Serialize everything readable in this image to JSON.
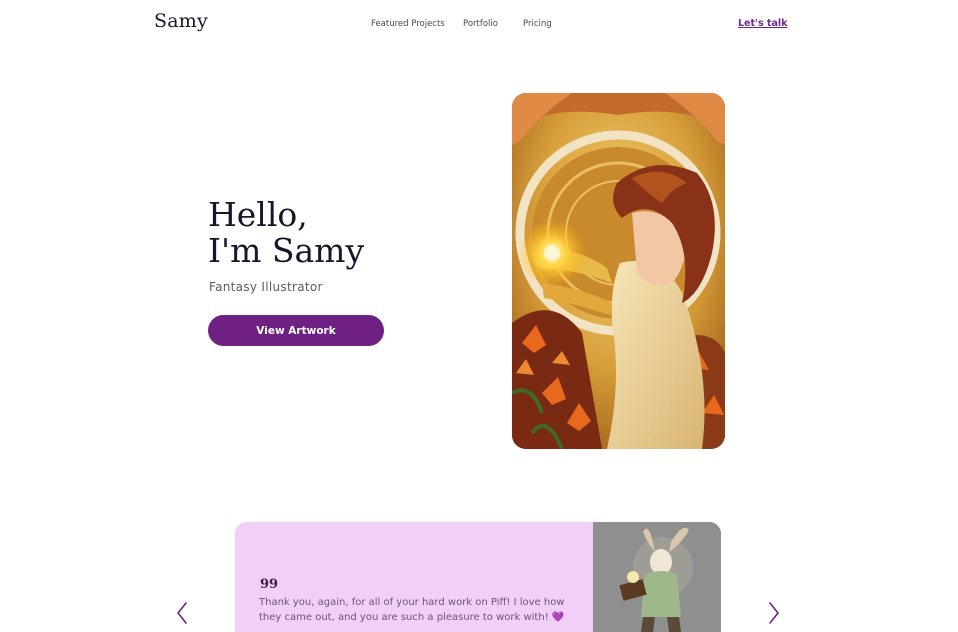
{
  "header": {
    "logo": "Samy",
    "nav": [
      "Featured Projects",
      "Portfolio",
      "Pricing"
    ],
    "cta": "Let's talk"
  },
  "hero": {
    "title_line1": "Hello,",
    "title_line2": "I'm Samy",
    "subtitle": "Fantasy Illustrator",
    "button": "View Artwork"
  },
  "testimonial": {
    "quote_mark": "99",
    "text": "Thank you, again, for all of your hard work on Piff! I love how they came out, and you are such a pleasure to work with!",
    "emoji": "💜"
  },
  "icons": {
    "prev": "chevron-left-icon",
    "next": "chevron-right-icon"
  },
  "colors": {
    "accent": "#6e2183",
    "testimonial_bg": "#f1cff8",
    "link": "#6b2a86"
  }
}
